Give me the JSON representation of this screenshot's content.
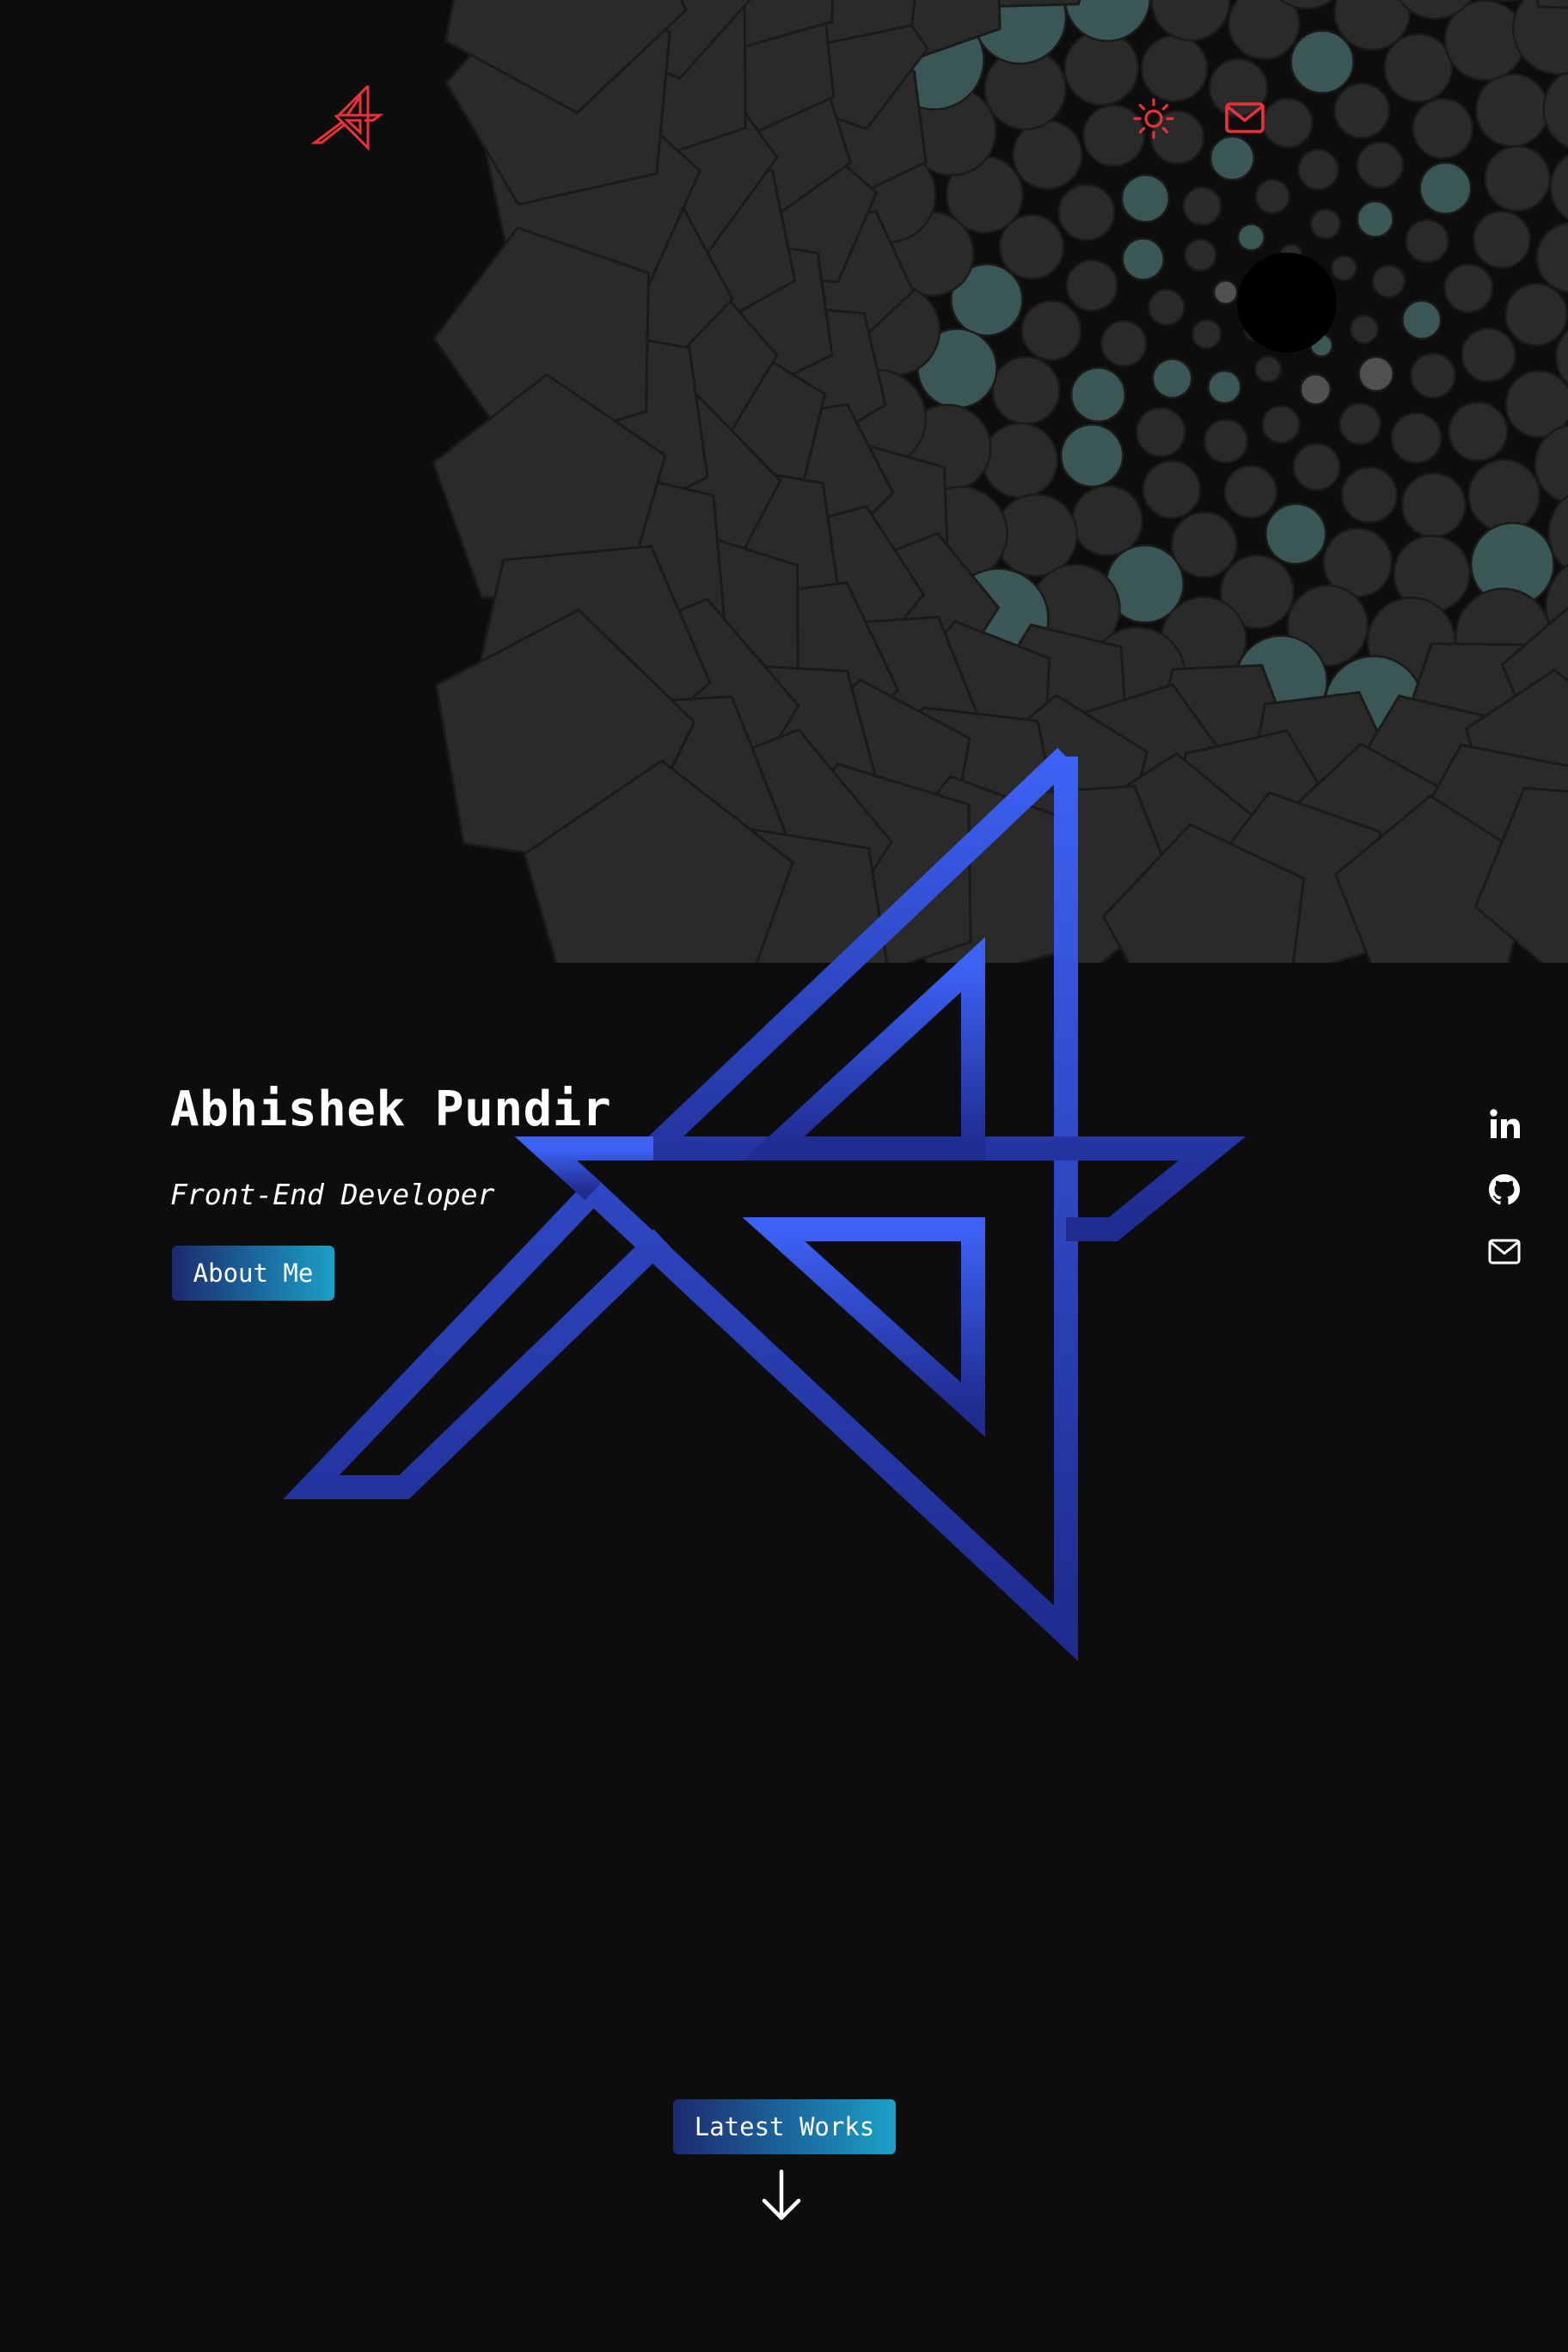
{
  "header": {
    "logo_icon": "ap-monogram-logo",
    "nav_icons": [
      "sun-icon",
      "mail-icon"
    ],
    "accent_color": "#e8323c"
  },
  "hero": {
    "name": "Abhishek Pundir",
    "role": "Front-End Developer",
    "about_button_label": "About Me",
    "emblem_icon": "ap-monogram-emblem",
    "emblem_colors": [
      "#3d62f5",
      "#1f2b8e"
    ]
  },
  "social": {
    "icons": [
      "linkedin-icon",
      "github-icon",
      "mail-icon"
    ]
  },
  "works": {
    "button_label": "Latest Works",
    "arrow_icon": "arrow-down-icon"
  },
  "theme": {
    "background": "#0d0d0e",
    "button_gradient": [
      "#1c2a6e",
      "#1aa0c6"
    ],
    "pattern_colors": [
      "#2a2a2b",
      "#3a5756",
      "#505050"
    ]
  }
}
